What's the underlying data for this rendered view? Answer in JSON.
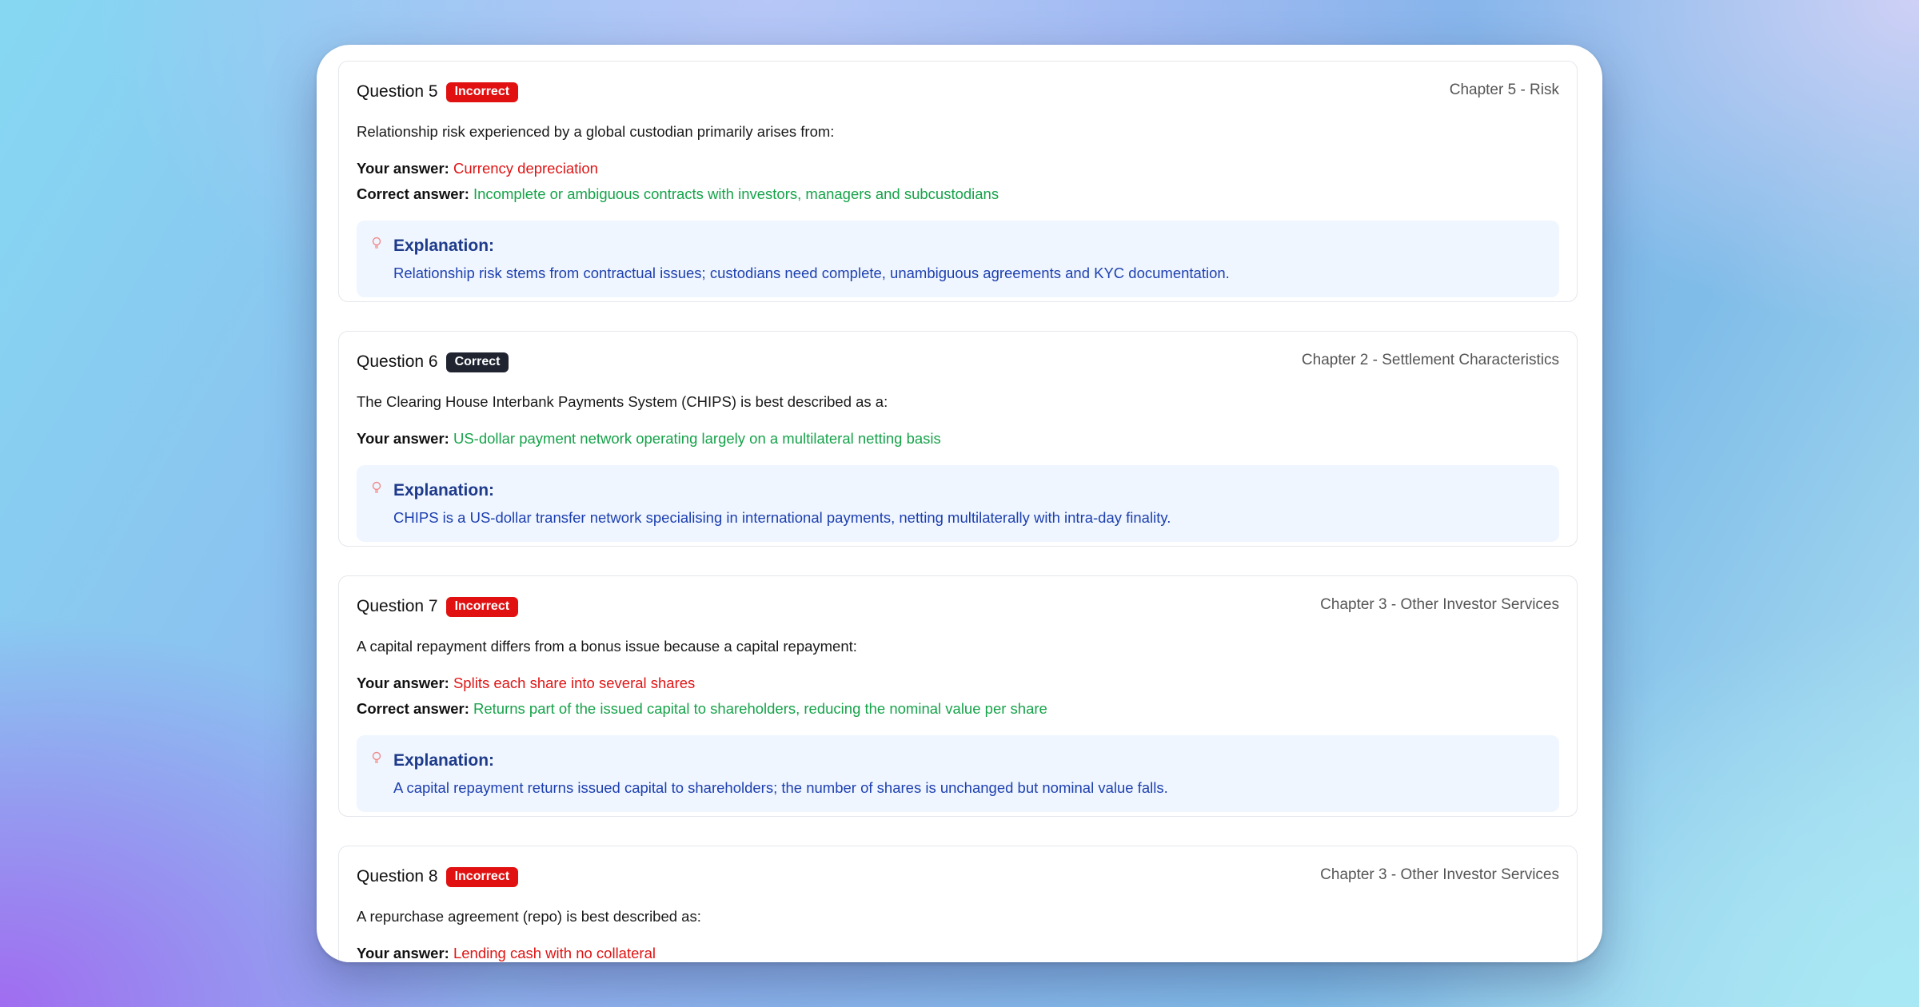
{
  "questions": [
    {
      "title": "Question 5",
      "status": "Incorrect",
      "chapter": "Chapter 5 - Risk",
      "prompt": "Relationship risk experienced by a global custodian primarily arises from:",
      "your_answer_label": "Your answer:",
      "your_answer": "Currency depreciation",
      "correct_answer_label": "Correct answer:",
      "correct_answer": "Incomplete or ambiguous contracts with investors, managers and subcustodians",
      "explanation_title": "Explanation:",
      "explanation": "Relationship risk stems from contractual issues; custodians need complete, unambiguous agreements and KYC documentation."
    },
    {
      "title": "Question 6",
      "status": "Correct",
      "chapter": "Chapter 2 - Settlement Characteristics",
      "prompt": "The Clearing House Interbank Payments System (CHIPS) is best described as a:",
      "your_answer_label": "Your answer:",
      "your_answer": "US-dollar payment network operating largely on a multilateral netting basis",
      "explanation_title": "Explanation:",
      "explanation": "CHIPS is a US-dollar transfer network specialising in international payments, netting multilaterally with intra-day finality."
    },
    {
      "title": "Question 7",
      "status": "Incorrect",
      "chapter": "Chapter 3 - Other Investor Services",
      "prompt": "A capital repayment differs from a bonus issue because a capital repayment:",
      "your_answer_label": "Your answer:",
      "your_answer": "Splits each share into several shares",
      "correct_answer_label": "Correct answer:",
      "correct_answer": "Returns part of the issued capital to shareholders, reducing the nominal value per share",
      "explanation_title": "Explanation:",
      "explanation": "A capital repayment returns issued capital to shareholders; the number of shares is unchanged but nominal value falls."
    },
    {
      "title": "Question 8",
      "status": "Incorrect",
      "chapter": "Chapter 3 - Other Investor Services",
      "prompt": "A repurchase agreement (repo) is best described as:",
      "your_answer_label": "Your answer:",
      "your_answer": "Lending cash with no collateral"
    }
  ],
  "icons": {
    "explanation": "lightbulb-icon"
  },
  "colors": {
    "incorrect_badge": "#e11111",
    "correct_badge": "#1f2430",
    "wrong_answer": "#e01414",
    "right_answer": "#16a34a",
    "explanation_bg": "#eff6ff",
    "explanation_text": "#1e40af"
  }
}
